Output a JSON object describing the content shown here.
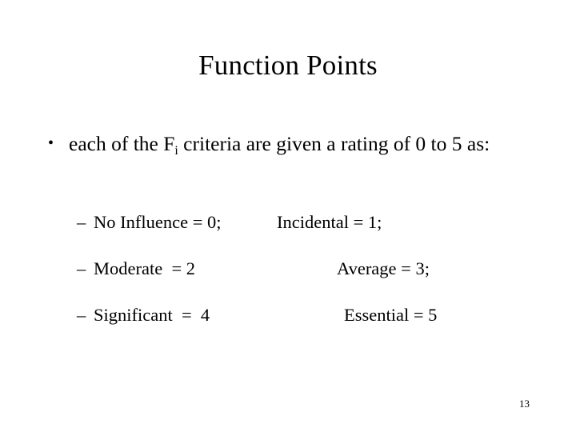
{
  "slide": {
    "title": "Function Points",
    "page_number": "13",
    "background_color": "#ffffff",
    "text_color": "#000000"
  },
  "bullet": {
    "marker": "•",
    "text_before_sub": "each of the F",
    "subscript": "i",
    "text_after_sub": " criteria are given a rating of 0 to 5 as:"
  },
  "sub_bullets": {
    "marker": "–",
    "rows": [
      {
        "left": "No Influence = 0;",
        "right": "Incidental = 1;"
      },
      {
        "left": "Moderate  = 2",
        "right": "Average = 3;"
      },
      {
        "left": "Significant  =  4",
        "right": "Essential = 5"
      }
    ]
  }
}
